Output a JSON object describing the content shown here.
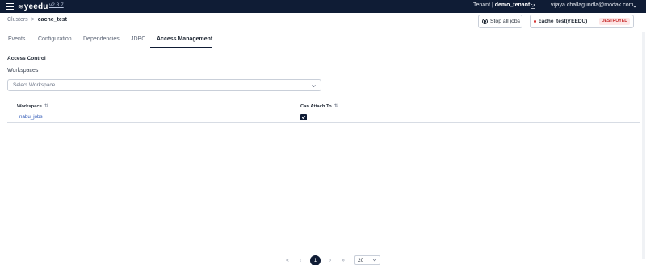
{
  "header": {
    "logo_mark": "≋",
    "logo_text": "yeedu",
    "version": "v2.8.7",
    "tenant_label": "Tenant |",
    "tenant_name": "demo_tenant",
    "user_email": "vijaya.challagundla@modak.com"
  },
  "breadcrumb": {
    "parent": "Clusters",
    "separator": ">",
    "current": "cache_test"
  },
  "actions": {
    "stop_all_jobs": "Stop all jobs"
  },
  "cluster_status": {
    "name": "cache_test(YEEDU)",
    "status": "DESTROYED",
    "status_color": "#c62828"
  },
  "tabs": [
    {
      "label": "Events"
    },
    {
      "label": "Configuration"
    },
    {
      "label": "Dependencies"
    },
    {
      "label": "JDBC"
    },
    {
      "label": "Access Management"
    }
  ],
  "active_tab": "Access Management",
  "access_control": {
    "title": "Access Control",
    "workspaces_label": "Workspaces",
    "select_placeholder": "Select Workspace",
    "columns": [
      "Workspace",
      "Can Attach To"
    ],
    "rows": [
      {
        "workspace": "nabu_jobs",
        "can_attach_to": true
      }
    ]
  },
  "pagination": {
    "first": "«",
    "prev": "‹",
    "current_page": "1",
    "next": "›",
    "last": "»",
    "page_size": "20"
  },
  "colors": {
    "navbar": "#0f1c35",
    "link": "#2c56b5",
    "accent": "#0f1c35"
  }
}
